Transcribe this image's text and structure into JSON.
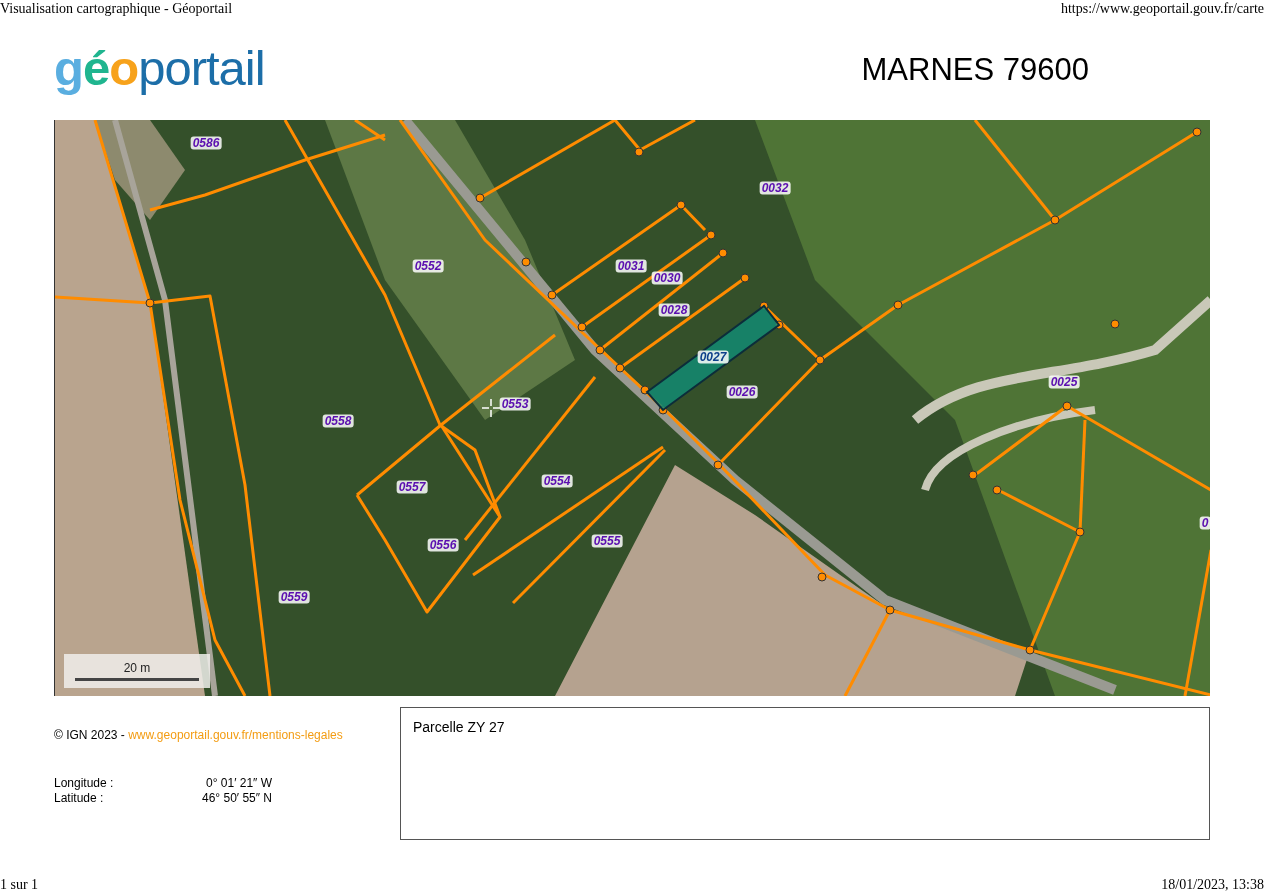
{
  "print_header": {
    "title": "Visualisation cartographique - Géoportail",
    "url": "https://www.geoportail.gouv.fr/carte"
  },
  "logo": [
    {
      "text": "g",
      "color": "#5aaee0"
    },
    {
      "text": "é",
      "color": "#1fb58f"
    },
    {
      "text": "o",
      "color": "#f7a21b"
    },
    {
      "text": "portail",
      "color": "#1c6ea8"
    }
  ],
  "place_title": "MARNES 79600",
  "map": {
    "scale": "20 m",
    "parcels": [
      {
        "label": "0586",
        "selected": false
      },
      {
        "label": "0032",
        "selected": false
      },
      {
        "label": "0552",
        "selected": false
      },
      {
        "label": "0031",
        "selected": false
      },
      {
        "label": "0030",
        "selected": false
      },
      {
        "label": "0028",
        "selected": false
      },
      {
        "label": "0027",
        "selected": true
      },
      {
        "label": "0026",
        "selected": false
      },
      {
        "label": "0025",
        "selected": false
      },
      {
        "label": "0553",
        "selected": false
      },
      {
        "label": "0558",
        "selected": false
      },
      {
        "label": "0557",
        "selected": false
      },
      {
        "label": "0554",
        "selected": false
      },
      {
        "label": "0556",
        "selected": false
      },
      {
        "label": "0555",
        "selected": false
      },
      {
        "label": "0559",
        "selected": false
      },
      {
        "label": "0",
        "selected": false
      }
    ]
  },
  "credits": {
    "prefix": "© IGN 2023 - ",
    "link": "www.geoportail.gouv.fr/mentions-legales"
  },
  "coordinates": [
    {
      "label": "Longitude :",
      "value": "0° 01′ 21″ W"
    },
    {
      "label": "Latitude :",
      "value": "46° 50′ 55″ N"
    }
  ],
  "info_box": {
    "text": "Parcelle ZY 27"
  },
  "print_footer": {
    "pages": "1 sur 1",
    "date": "18/01/2023, 13:38"
  }
}
